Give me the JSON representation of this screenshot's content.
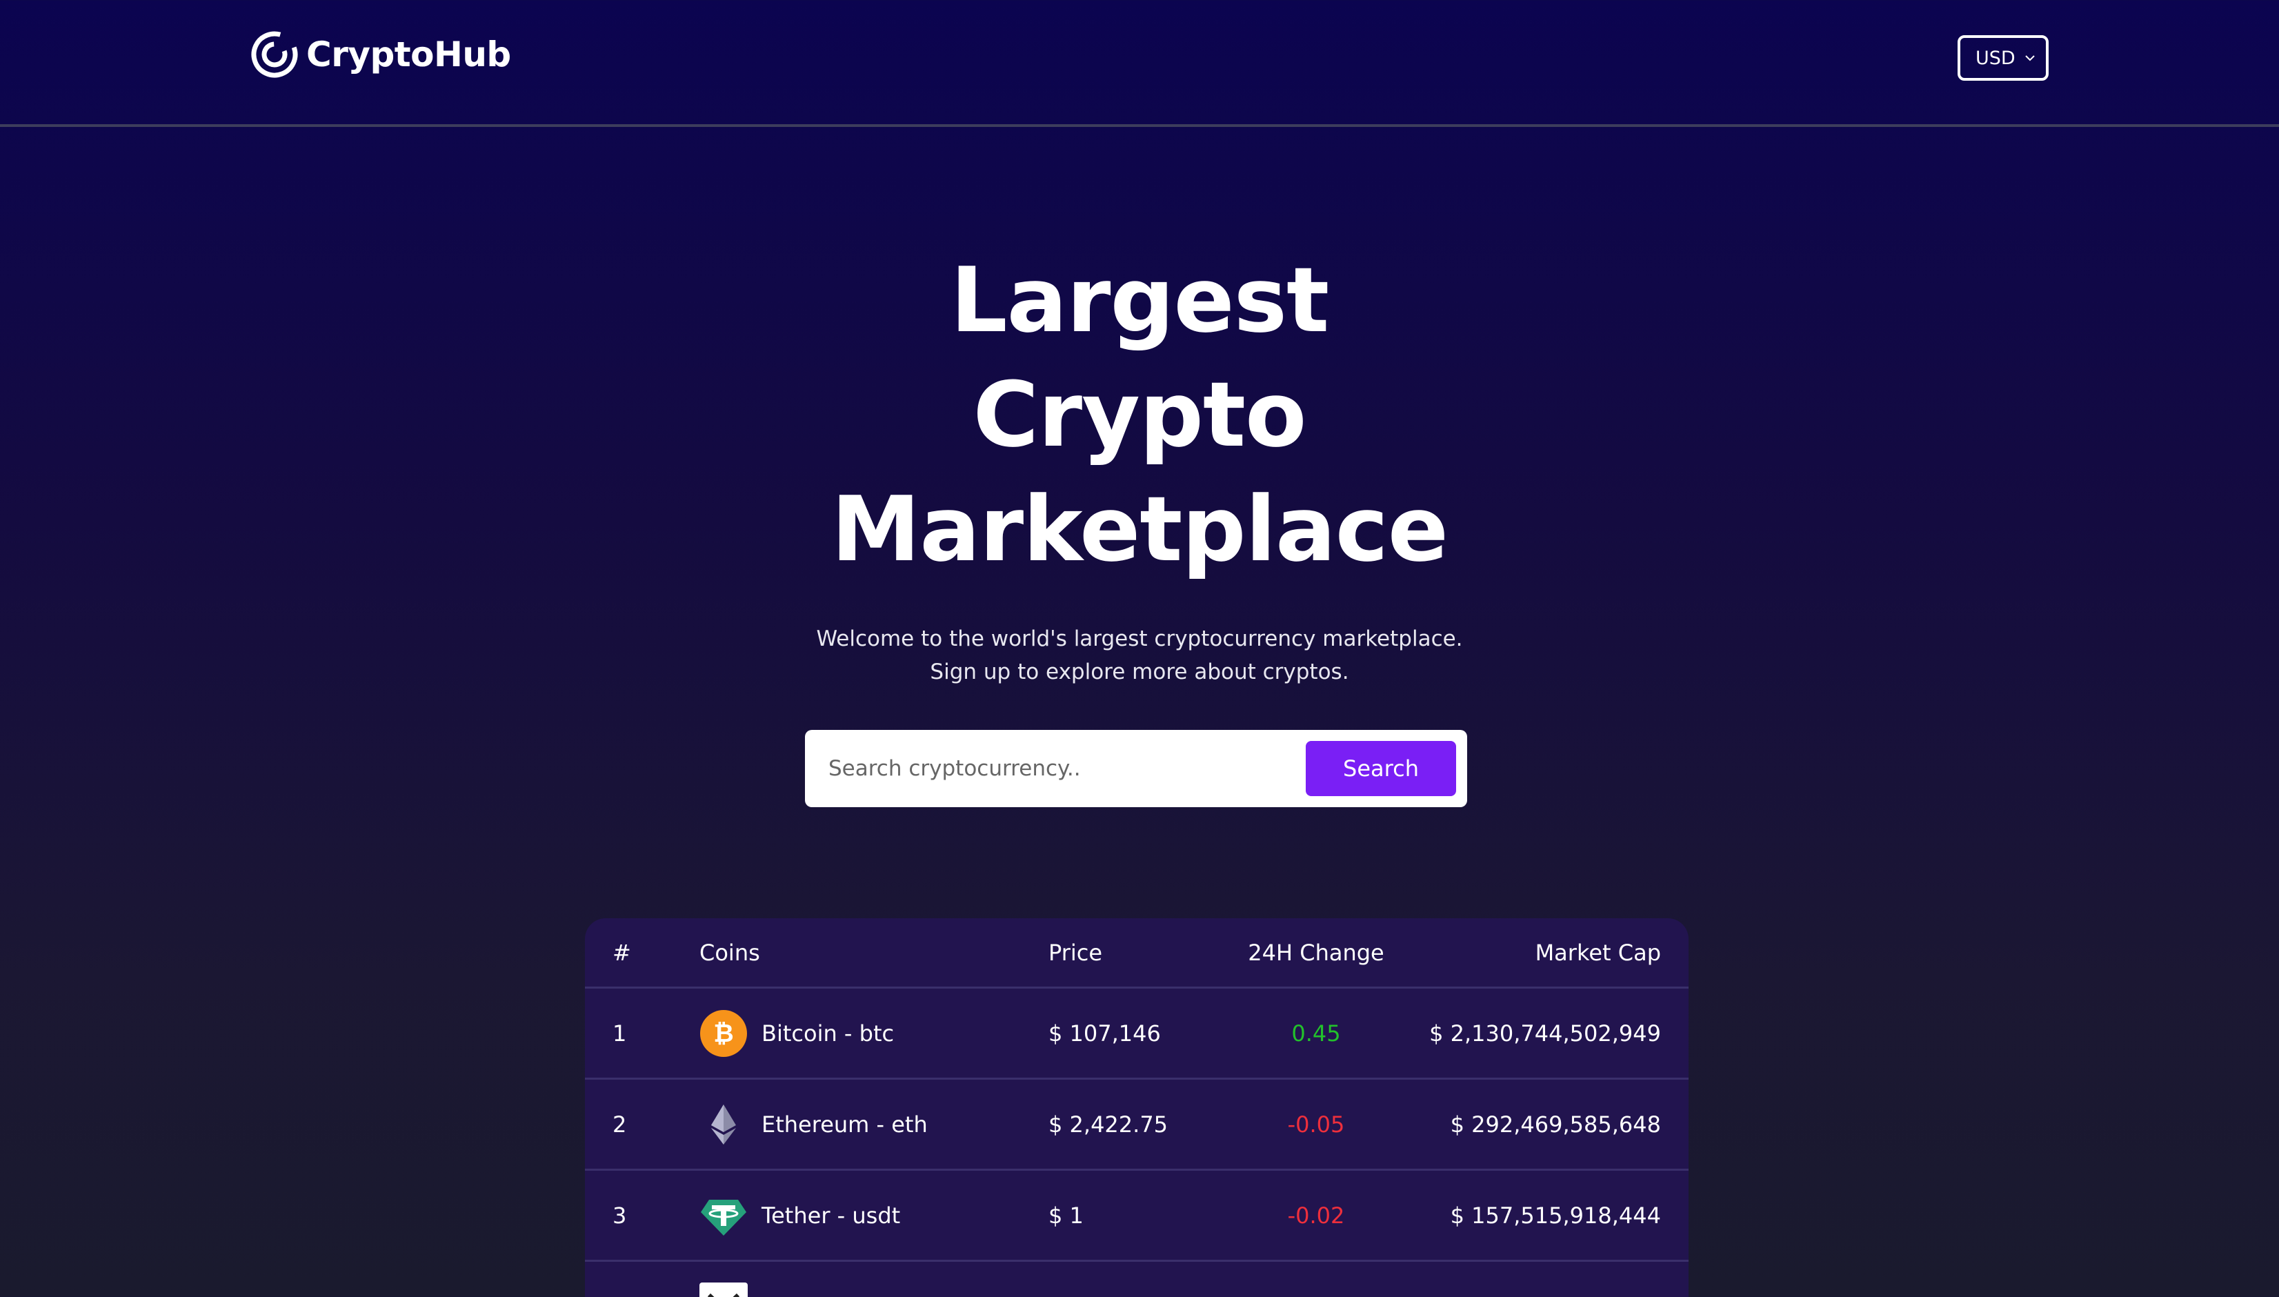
{
  "navbar": {
    "logo_text": "CryptoHub",
    "currency": "USD"
  },
  "hero": {
    "title_line1": "Largest",
    "title_line2": "Crypto",
    "title_line3": "Marketplace",
    "subtitle_line1": "Welcome to the world's largest cryptocurrency marketplace.",
    "subtitle_line2": "Sign up to explore more about cryptos."
  },
  "search": {
    "placeholder": "Search cryptocurrency..",
    "button_label": "Search"
  },
  "table": {
    "headers": {
      "rank": "#",
      "coins": "Coins",
      "price": "Price",
      "change": "24H Change",
      "market_cap": "Market Cap"
    },
    "rows": [
      {
        "rank": "1",
        "coin": "Bitcoin - btc",
        "icon": "bitcoin-icon",
        "price": "$ 107,146",
        "change": "0.45",
        "change_color": "#22c12b",
        "market_cap": "$ 2,130,744,502,949"
      },
      {
        "rank": "2",
        "coin": "Ethereum - eth",
        "icon": "ethereum-icon",
        "price": "$ 2,422.75",
        "change": "-0.05",
        "change_color": "#ee2f3c",
        "market_cap": "$ 292,469,585,648"
      },
      {
        "rank": "3",
        "coin": "Tether - usdt",
        "icon": "tether-icon",
        "price": "$ 1",
        "change": "-0.02",
        "change_color": "#ee2f3c",
        "market_cap": "$ 157,515,918,444"
      }
    ]
  },
  "colors": {
    "accent": "#7a1ff5",
    "positive": "#22c12b",
    "negative": "#ee2f3c",
    "table_bg": "#22144f"
  }
}
